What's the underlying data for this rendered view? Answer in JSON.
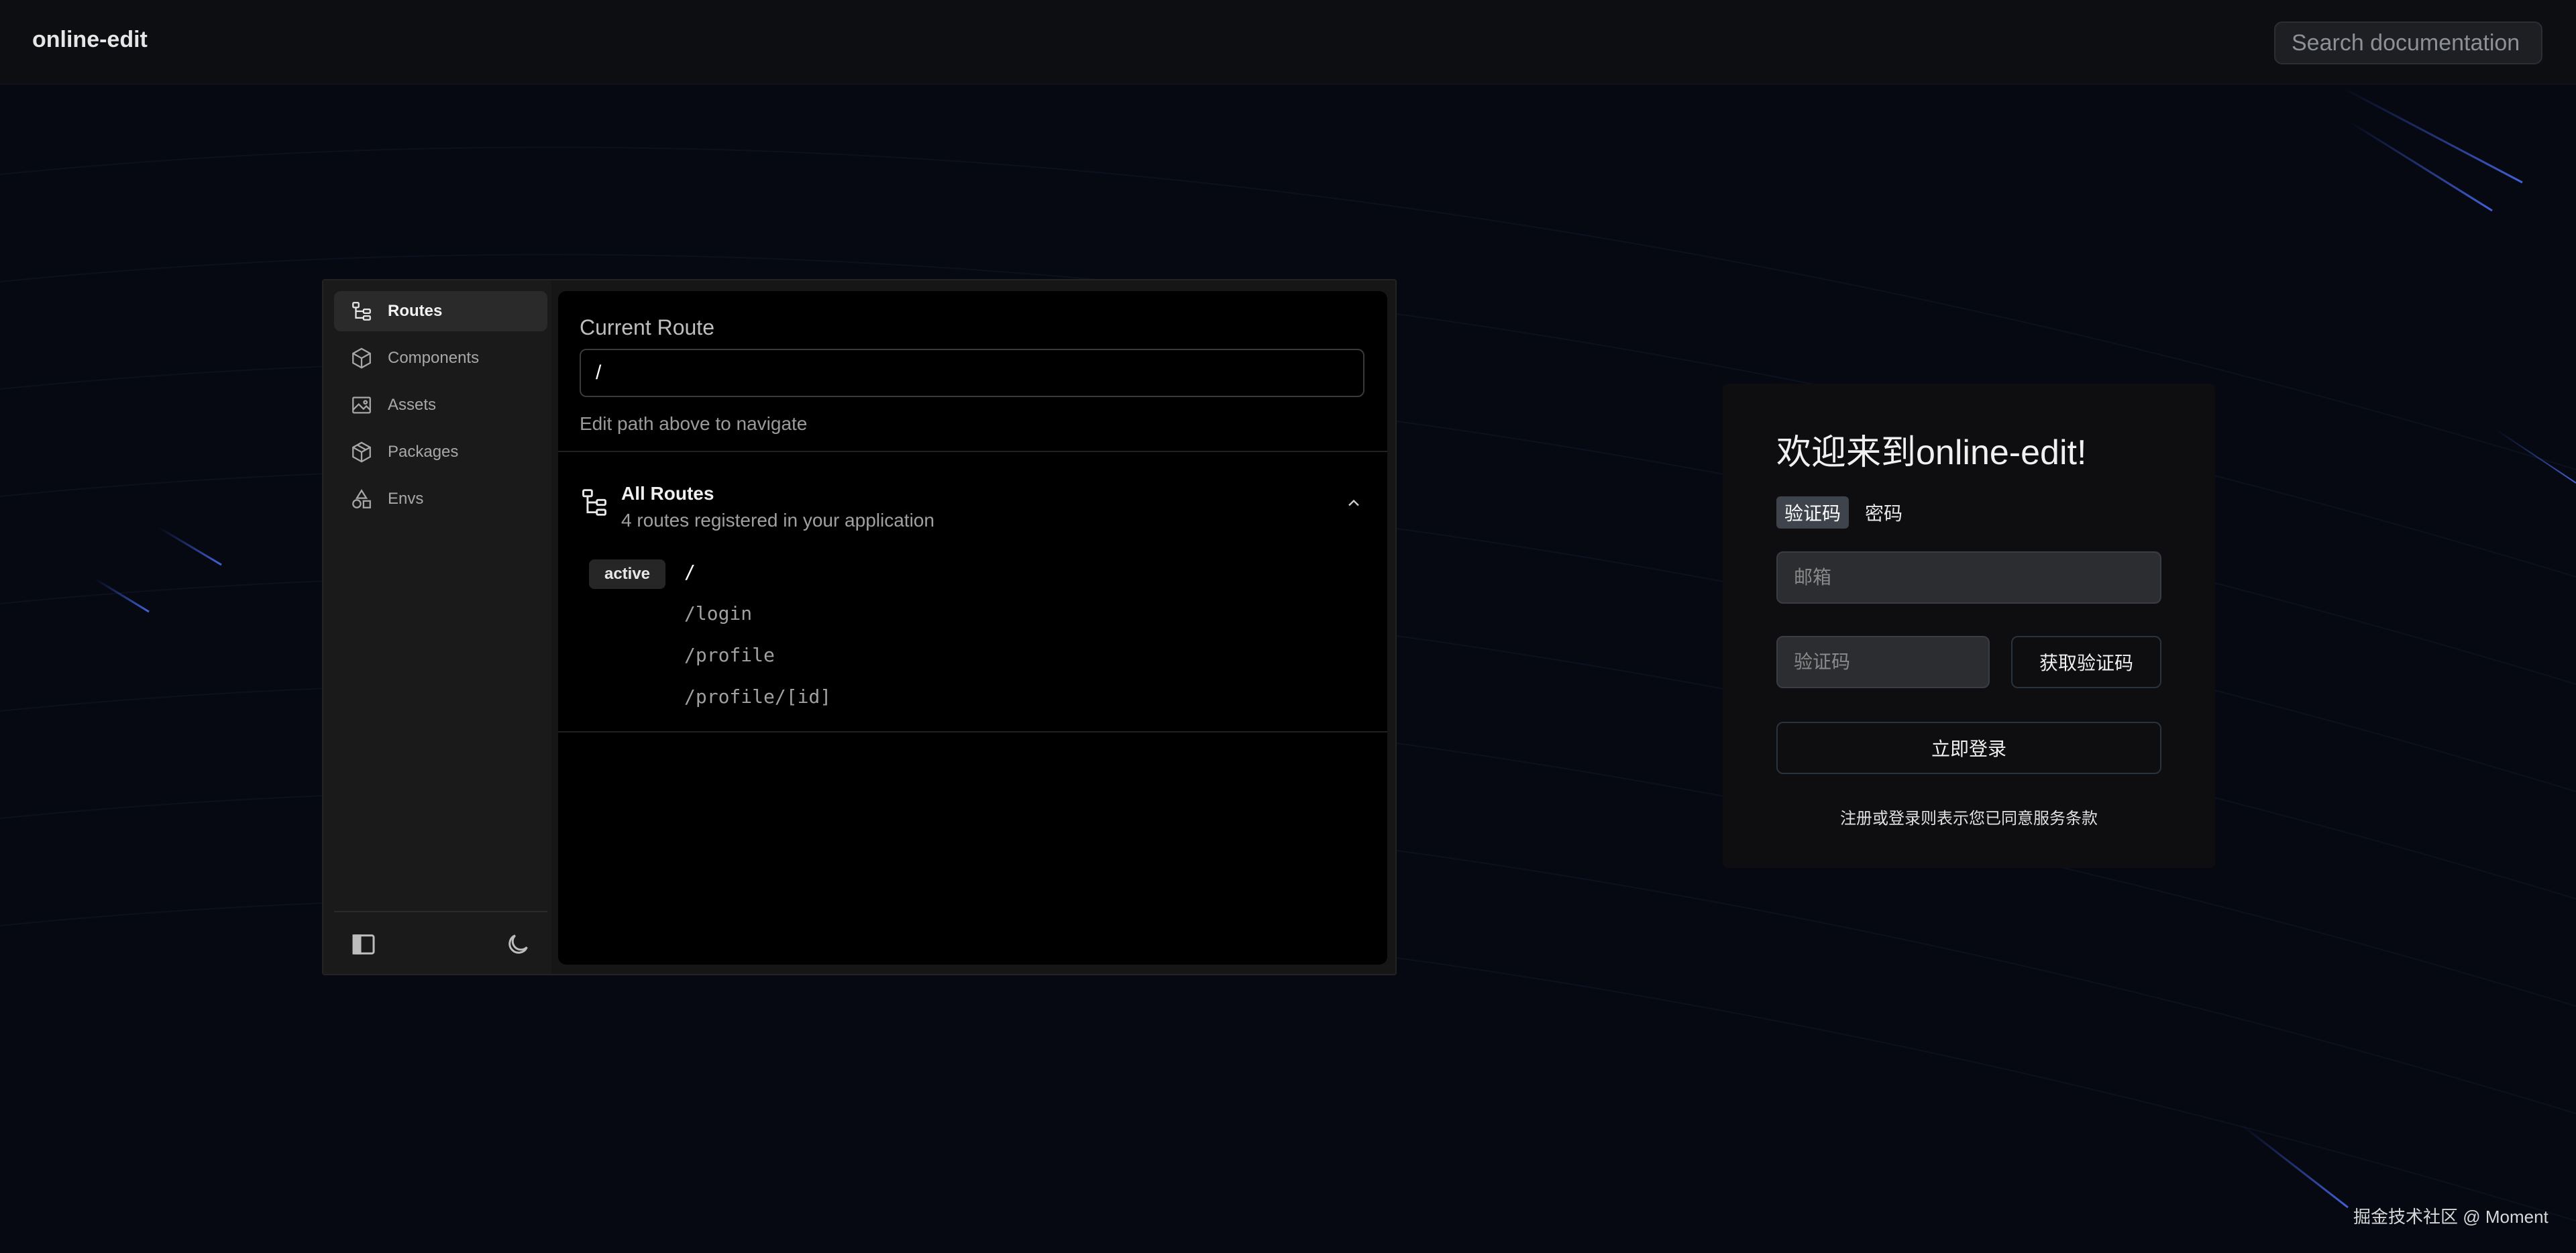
{
  "app": {
    "title": "online-edit"
  },
  "search": {
    "placeholder": "Search documentation"
  },
  "devtools": {
    "sidebar": {
      "items": [
        {
          "label": "Routes",
          "icon": "route-tree-icon",
          "active": true
        },
        {
          "label": "Components",
          "icon": "cube-icon",
          "active": false
        },
        {
          "label": "Assets",
          "icon": "image-icon",
          "active": false
        },
        {
          "label": "Packages",
          "icon": "package-icon",
          "active": false
        },
        {
          "label": "Envs",
          "icon": "shapes-icon",
          "active": false
        }
      ],
      "footer_icons": [
        "sidebar-toggle-icon",
        "moon-icon"
      ]
    },
    "current_route": {
      "title": "Current Route",
      "value": "/",
      "hint": "Edit path above to navigate"
    },
    "all_routes": {
      "title": "All Routes",
      "subtitle": "4 routes registered in your application",
      "active_badge": "active",
      "routes": [
        "/",
        "/login",
        "/profile",
        "/profile/[id]"
      ]
    }
  },
  "login": {
    "title": "欢迎来到online-edit!",
    "tabs": [
      "验证码",
      "密码"
    ],
    "email_placeholder": "邮箱",
    "code_placeholder": "验证码",
    "get_code_label": "获取验证码",
    "submit_label": "立即登录",
    "terms": "注册或登录则表示您已同意服务条款"
  },
  "credit": "掘金技术社区 @ Moment",
  "colors": {
    "background": "#060912",
    "topbar": "#0d0e11",
    "panel": "#161616",
    "main": "#000000",
    "accent_lines": "#3a5bd9"
  }
}
